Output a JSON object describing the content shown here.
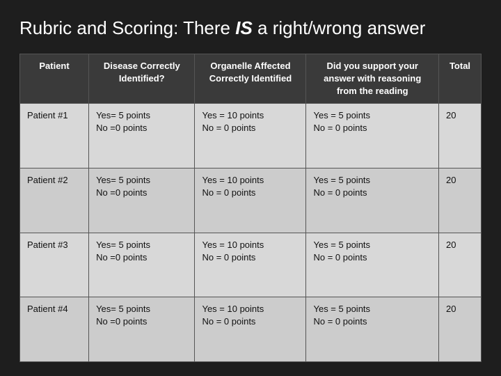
{
  "title": {
    "prefix": "Rubric and Scoring: There ",
    "highlight": "IS",
    "suffix": " a right/wrong answer"
  },
  "table": {
    "headers": [
      {
        "key": "patient",
        "label": "Patient"
      },
      {
        "key": "disease",
        "label": "Disease Correctly Identified?"
      },
      {
        "key": "organelle",
        "label": "Organelle Affected Correctly Identified"
      },
      {
        "key": "reasoning",
        "label": "Did you support your answer with reasoning from the reading"
      },
      {
        "key": "total",
        "label": "Total"
      }
    ],
    "rows": [
      {
        "patient": "Patient #1",
        "disease": "Yes= 5 points\nNo =0 points",
        "organelle": "Yes = 10 points\nNo = 0 points",
        "reasoning": "Yes = 5 points\nNo = 0 points",
        "total": "20"
      },
      {
        "patient": "Patient #2",
        "disease": "Yes= 5 points\nNo =0 points",
        "organelle": "Yes = 10 points\nNo = 0 points",
        "reasoning": "Yes = 5 points\nNo = 0 points",
        "total": "20"
      },
      {
        "patient": "Patient #3",
        "disease": "Yes= 5 points\nNo =0 points",
        "organelle": "Yes = 10 points\nNo = 0 points",
        "reasoning": "Yes = 5 points\nNo = 0 points",
        "total": "20"
      },
      {
        "patient": "Patient #4",
        "disease": "Yes= 5 points\nNo =0 points",
        "organelle": "Yes = 10 points\nNo = 0 points",
        "reasoning": "Yes = 5 points\nNo = 0 points",
        "total": "20"
      }
    ]
  }
}
